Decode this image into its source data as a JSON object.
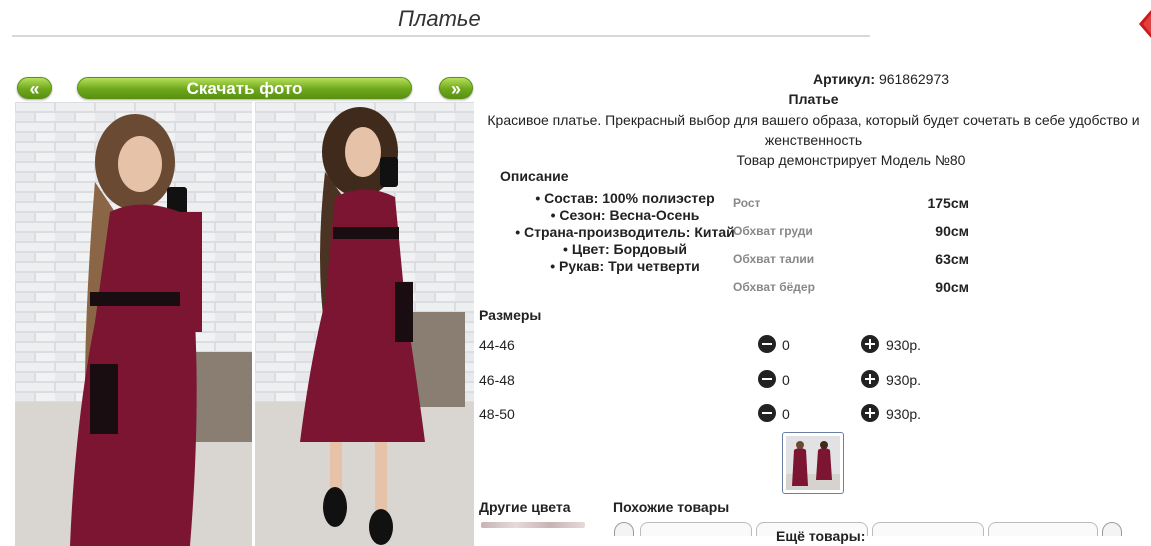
{
  "header": {
    "title": "Платье"
  },
  "gallery": {
    "prev_label": "«",
    "download_label": "Скачать фото",
    "next_label": "»"
  },
  "product": {
    "article_label": "Артикул:",
    "article_value": "961862973",
    "name": "Платье",
    "description": "Красивое платье. Прекрасный выбор для вашего образа, который будет сочетать в себе удобство и женственность",
    "model_note": "Товар демонстрирует Модель №80"
  },
  "specs": {
    "heading": "Описание",
    "items": [
      "Состав: 100% полиэстер",
      "Сезон: Весна-Осень",
      "Страна-производитель: Китай",
      "Цвет: Бордовый",
      "Рукав: Три четверти"
    ]
  },
  "measurements": [
    {
      "label": "Рост",
      "value": "175см"
    },
    {
      "label": "Обхват груди",
      "value": "90см"
    },
    {
      "label": "Обхват талии",
      "value": "63см"
    },
    {
      "label": "Обхват бёдер",
      "value": "90см"
    }
  ],
  "sizes": {
    "heading": "Размеры",
    "rows": [
      {
        "size": "44-46",
        "qty": "0",
        "price": "930р."
      },
      {
        "size": "46-48",
        "qty": "0",
        "price": "930р."
      },
      {
        "size": "48-50",
        "qty": "0",
        "price": "930р."
      }
    ]
  },
  "footer": {
    "other_colors": "Другие цвета",
    "similar": "Похожие товары",
    "more": "Ещё товары:"
  },
  "colors": {
    "accent_green": "#6ea81c",
    "dress": "#7c1532",
    "close_red": "#cc1a1a"
  }
}
